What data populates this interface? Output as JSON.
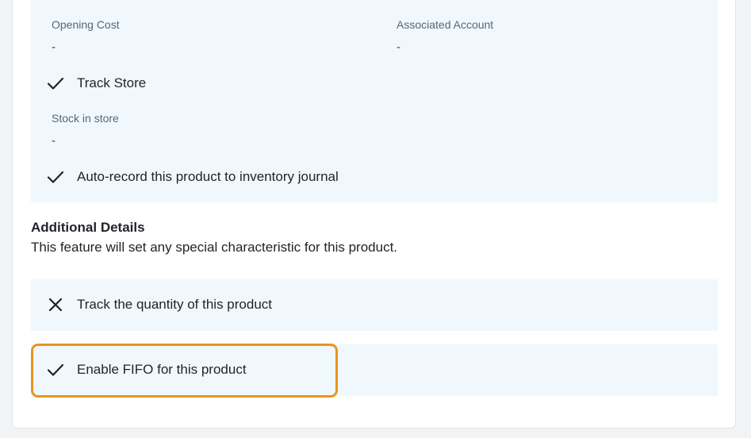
{
  "inventory": {
    "opening_cost_label": "Opening Cost",
    "opening_cost_value": "-",
    "associated_account_label": "Associated Account",
    "associated_account_value": "-",
    "track_store_label": "Track Store",
    "track_store_checked": true,
    "stock_in_store_label": "Stock in store",
    "stock_in_store_value": "-",
    "auto_record_label": "Auto-record this product to inventory journal",
    "auto_record_checked": true
  },
  "additional_details": {
    "title": "Additional Details",
    "description": "This feature will set any special characteristic for this product.",
    "track_quantity_label": "Track the quantity of this product",
    "track_quantity_checked": false,
    "enable_fifo_label": "Enable FIFO for this product",
    "enable_fifo_checked": true
  },
  "colors": {
    "panel_bg": "#f0f8fd",
    "highlight": "#e8951e"
  },
  "icons": {
    "check": "check-icon",
    "cross": "close-icon"
  }
}
